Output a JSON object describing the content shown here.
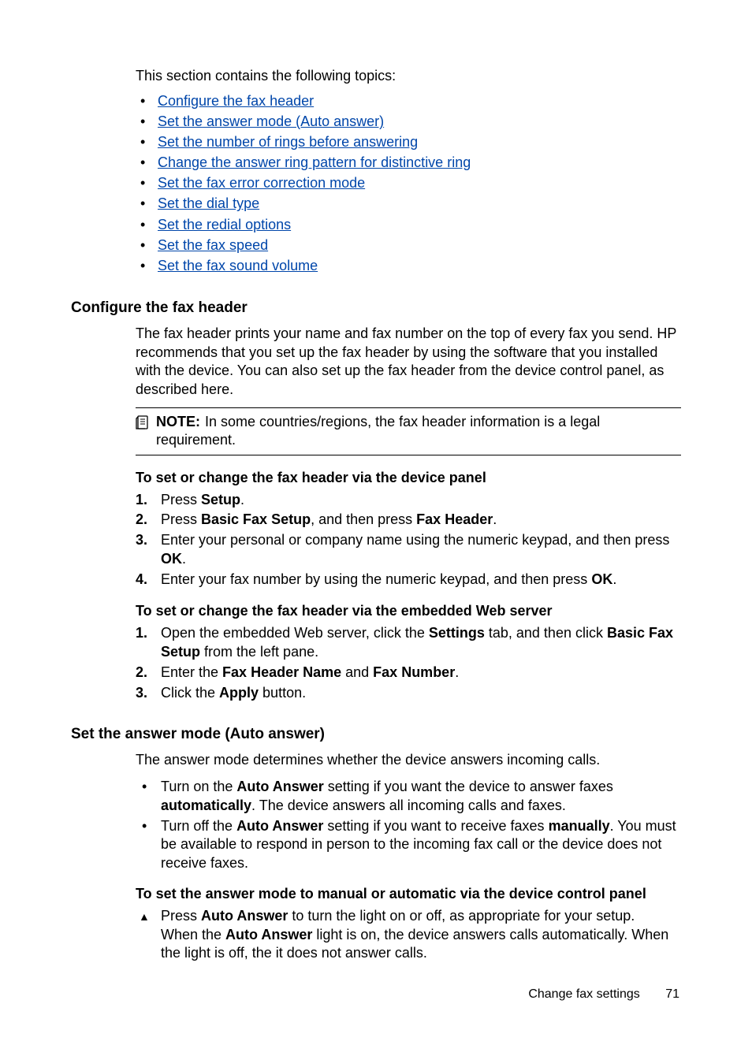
{
  "intro": "This section contains the following topics:",
  "toc": [
    "Configure the fax header",
    "Set the answer mode (Auto answer)",
    "Set the number of rings before answering",
    "Change the answer ring pattern for distinctive ring",
    "Set the fax error correction mode",
    "Set the dial type",
    "Set the redial options",
    "Set the fax speed",
    "Set the fax sound volume"
  ],
  "s1": {
    "title": "Configure the fax header",
    "body": "The fax header prints your name and fax number on the top of every fax you send. HP recommends that you set up the fax header by using the software that you installed with the device. You can also set up the fax header from the device control panel, as described here.",
    "note_label": "NOTE:",
    "note_text": "In some countries/regions, the fax header information is a legal requirement.",
    "h1": "To set or change the fax header via the device panel",
    "steps1": {
      "s1a": "Press ",
      "s1b": "Setup",
      "s1c": ".",
      "s2a": "Press ",
      "s2b": "Basic Fax Setup",
      "s2c": ", and then press ",
      "s2d": "Fax Header",
      "s2e": ".",
      "s3a": "Enter your personal or company name using the numeric keypad, and then press ",
      "s3b": "OK",
      "s3c": ".",
      "s4a": "Enter your fax number by using the numeric keypad, and then press ",
      "s4b": "OK",
      "s4c": "."
    },
    "h2": "To set or change the fax header via the embedded Web server",
    "steps2": {
      "s1a": "Open the embedded Web server, click the ",
      "s1b": "Settings",
      "s1c": " tab, and then click ",
      "s1d": "Basic Fax Setup",
      "s1e": " from the left pane.",
      "s2a": "Enter the ",
      "s2b": "Fax Header Name",
      "s2c": " and ",
      "s2d": "Fax Number",
      "s2e": ".",
      "s3a": "Click the ",
      "s3b": "Apply",
      "s3c": " button."
    }
  },
  "s2": {
    "title": "Set the answer mode (Auto answer)",
    "body": "The answer mode determines whether the device answers incoming calls.",
    "bullets": {
      "b1a": "Turn on the ",
      "b1b": "Auto Answer",
      "b1c": " setting if you want the device to answer faxes ",
      "b1d": "automatically",
      "b1e": ". The device answers all incoming calls and faxes.",
      "b2a": "Turn off the ",
      "b2b": "Auto Answer",
      "b2c": " setting if you want to receive faxes ",
      "b2d": "manually",
      "b2e": ". You must be available to respond in person to the incoming fax call or the device does not receive faxes."
    },
    "h1": "To set the answer mode to manual or automatic via the device control panel",
    "tri": {
      "t1a": "Press ",
      "t1b": "Auto Answer",
      "t1c": " to turn the light on or off, as appropriate for your setup.",
      "t2a": "When the ",
      "t2b": "Auto Answer",
      "t2c": " light is on, the device answers calls automatically. When the light is off, the it does not answer calls."
    }
  },
  "footer": {
    "text": "Change fax settings",
    "page": "71"
  }
}
